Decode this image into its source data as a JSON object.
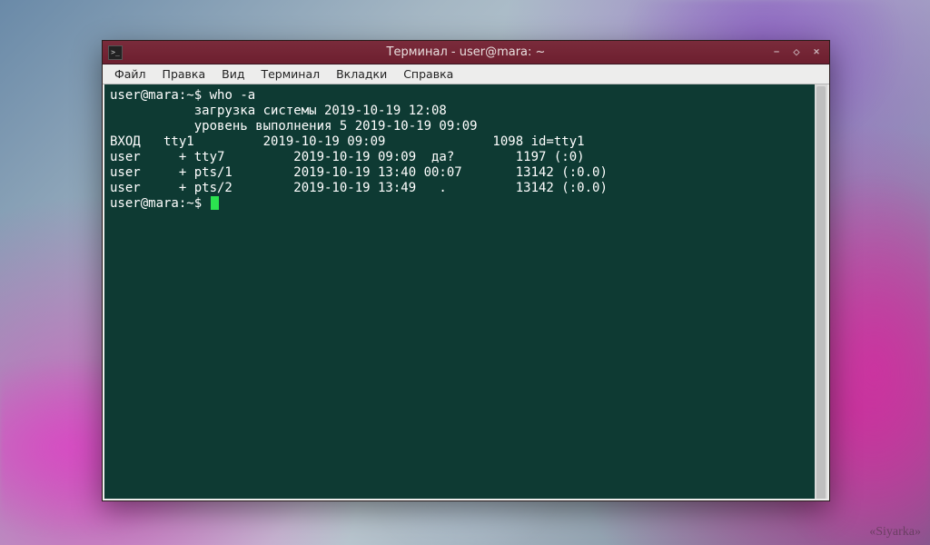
{
  "window": {
    "title": "Терминал - user@mara: ~"
  },
  "menubar": {
    "items": [
      "Файл",
      "Правка",
      "Вид",
      "Терминал",
      "Вкладки",
      "Справка"
    ]
  },
  "terminal": {
    "prompt": {
      "userhost": "user@mara",
      "path": "~",
      "sep1": ":",
      "sep2": "$"
    },
    "command1": "who -a",
    "lines": [
      "           загрузка системы 2019-10-19 12:08",
      "           уровень выполнения 5 2019-10-19 09:09",
      "ВХОД   tty1         2019-10-19 09:09              1098 id=tty1",
      "user     + tty7         2019-10-19 09:09  да?        1197 (:0)",
      "user     + pts/1        2019-10-19 13:40 00:07       13142 (:0.0)",
      "user     + pts/2        2019-10-19 13:49   .         13142 (:0.0)"
    ]
  },
  "watermark": "«Siyarka»"
}
